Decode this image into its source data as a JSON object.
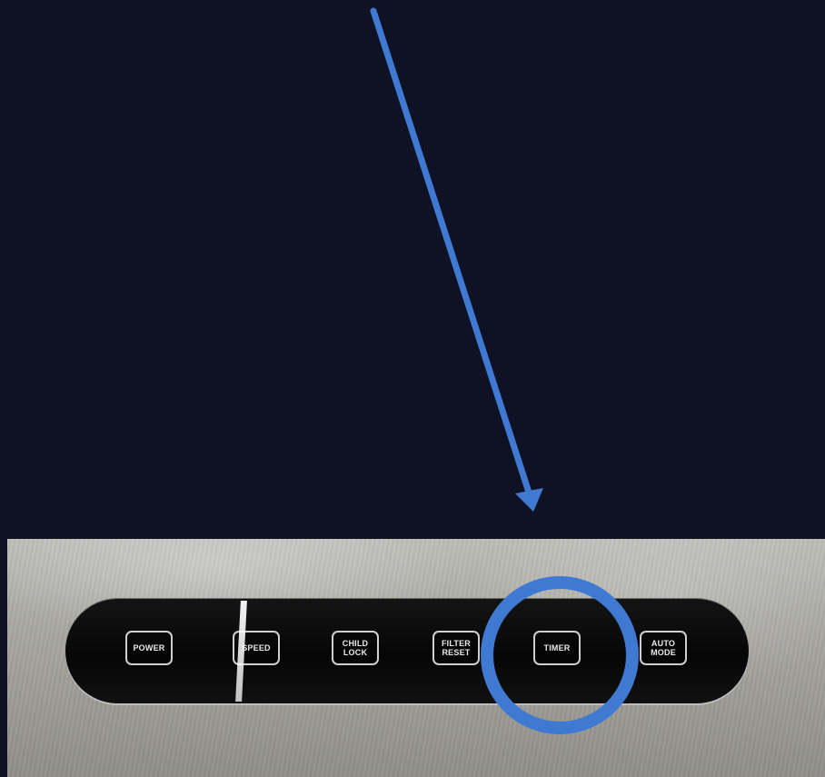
{
  "buttons": [
    {
      "id": "power",
      "label": "POWER"
    },
    {
      "id": "speed",
      "label": "SPEED"
    },
    {
      "id": "child-lock",
      "label": "CHILD\nLOCK"
    },
    {
      "id": "filter-reset",
      "label": "FILTER\nRESET"
    },
    {
      "id": "timer",
      "label": "TIMER"
    },
    {
      "id": "auto-mode",
      "label": "AUTO\nMODE"
    }
  ],
  "highlighted_button": "TIMER",
  "annotation": {
    "arrow_color": "#3f79d1",
    "circle_color": "#3f79d1"
  },
  "colors": {
    "background": "#0e1224",
    "panel": "#0a0a0a",
    "metal": "#a9a8a3"
  }
}
